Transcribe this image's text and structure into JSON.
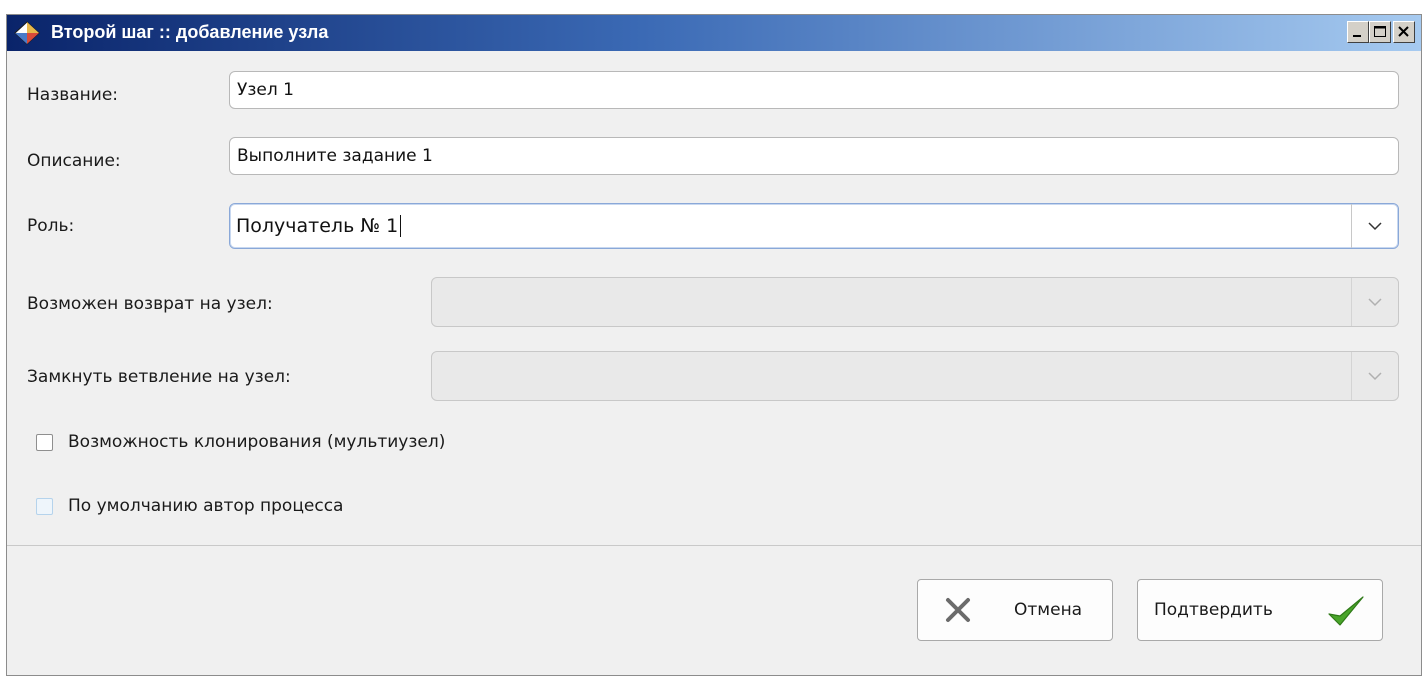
{
  "window": {
    "title": "Второй шаг :: добавление узла"
  },
  "form": {
    "name_label": "Название:",
    "name_value": "Узел 1",
    "description_label": "Описание:",
    "description_value": "Выполните задание 1",
    "role_label": "Роль:",
    "role_value": "Получатель № 1",
    "return_label": "Возможен возврат на узел:",
    "return_value": "",
    "close_branch_label": "Замкнуть ветвление на узел:",
    "close_branch_value": "",
    "clone_label": "Возможность клонирования (мультиузел)",
    "clone_checked": false,
    "author_label": "По умолчанию автор процесса",
    "author_checked": false
  },
  "buttons": {
    "cancel_label": "Отмена",
    "confirm_label": "Подтвердить"
  },
  "icons": {
    "title": "diamond-app-icon",
    "cancel": "x-icon",
    "confirm": "checkmark-icon"
  },
  "colors": {
    "title_gradient_start": "#0a246a",
    "title_gradient_end": "#a6caf0",
    "confirm_check": "#4aa52a",
    "cancel_x": "#6b6b6b"
  }
}
